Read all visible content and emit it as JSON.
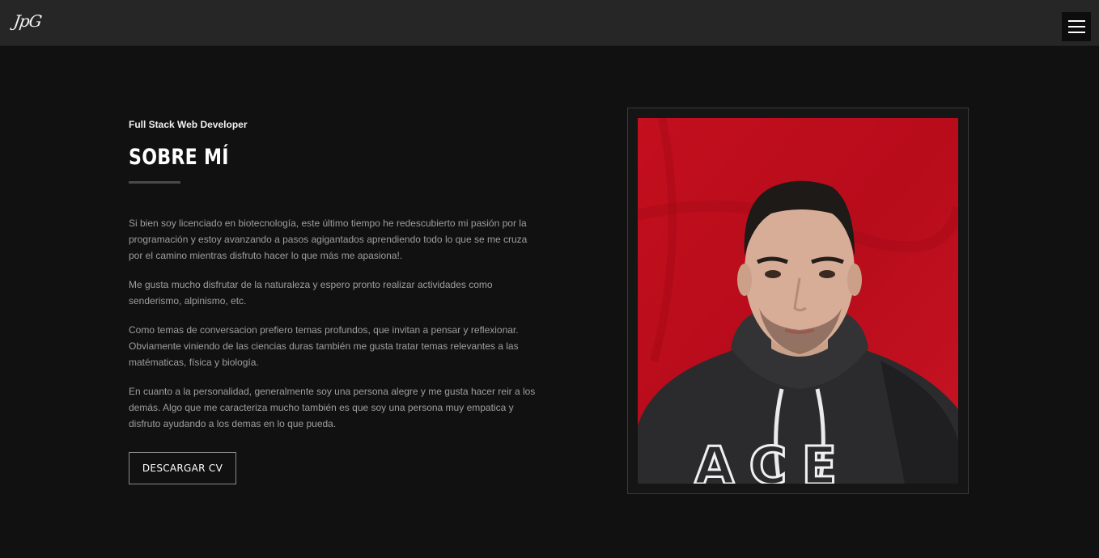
{
  "header": {
    "logo_text": "JpG",
    "menu_icon": "hamburger-menu-icon"
  },
  "about": {
    "subtitle": "Full Stack Web Developer",
    "title": "SOBRE MÍ",
    "paragraphs": [
      "Si bien soy licenciado en biotecnología, este último tiempo he redescubierto mi pasión por la programación y estoy avanzando a pasos agigantados aprendiendo todo lo que se me cruza por el camino mientras disfruto hacer lo que más me apasiona!.",
      "Me gusta mucho disfrutar de la naturaleza y espero pronto realizar actividades como senderismo, alpinismo, etc.",
      "Como temas de conversacion prefiero temas profundos, que invitan a pensar y reflexionar. Obviamente viniendo de las ciencias duras también me gusta tratar temas relevantes a las matématicas, física y biología.",
      "En cuanto a la personalidad, generalmente soy una persona alegre y me gusta hacer reir a los demás. Algo que me caracteriza mucho también es que soy una persona muy empatica y disfruto ayudando a los demas en lo que pueda."
    ],
    "cv_button": "DESCARGAR CV",
    "photo_text": "ACE"
  },
  "colors": {
    "background": "#111111",
    "header_bg": "#262626",
    "photo_bg": "#c0111f",
    "text_muted": "#9e9e9e"
  }
}
